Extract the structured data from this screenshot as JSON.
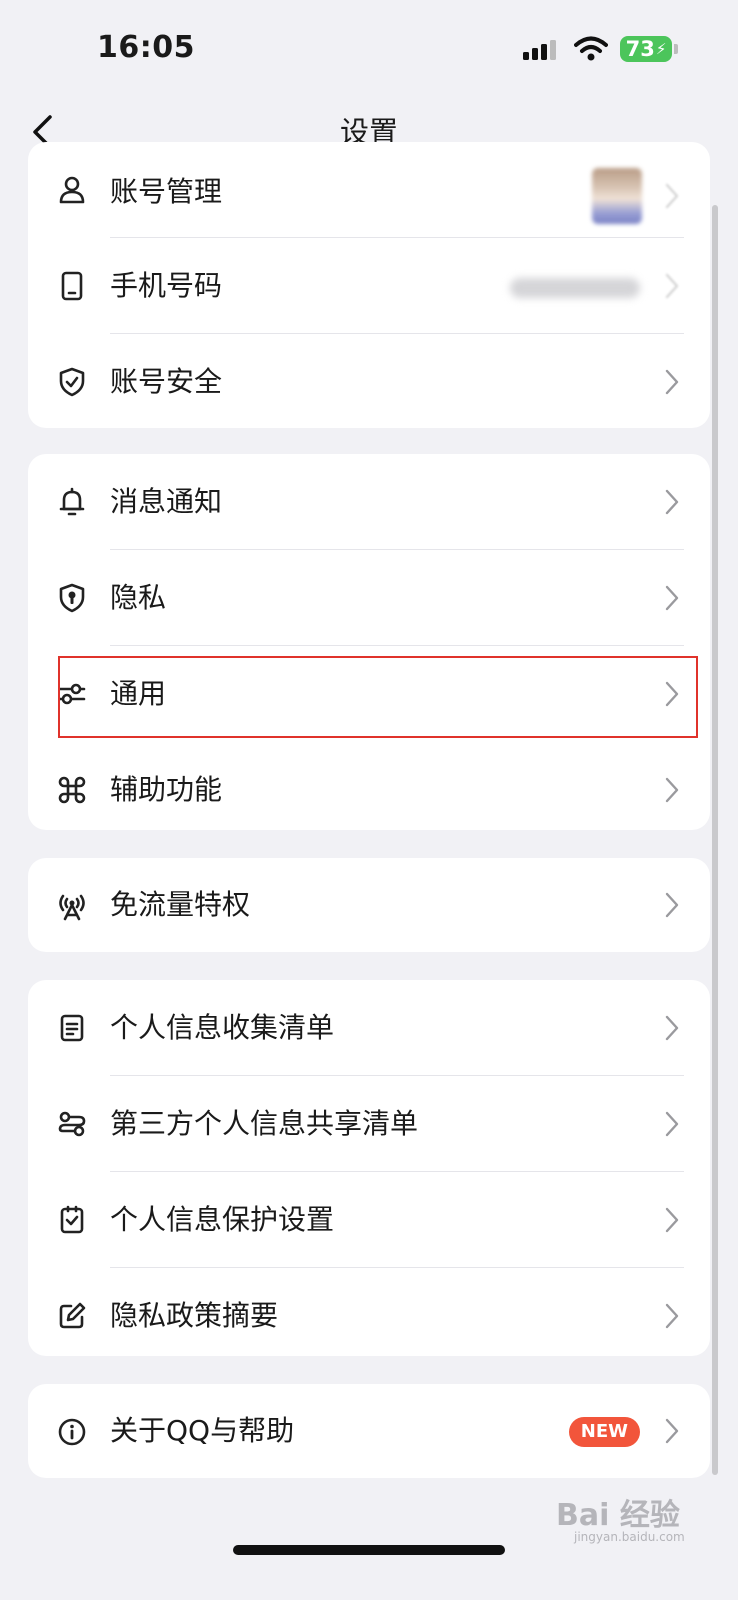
{
  "status_bar": {
    "time": "16:05",
    "battery": "73"
  },
  "nav": {
    "title": "设置"
  },
  "groups": [
    {
      "items": [
        {
          "icon": "person-icon",
          "label": "账号管理"
        },
        {
          "icon": "phone-icon",
          "label": "手机号码"
        },
        {
          "icon": "shield-check-icon",
          "label": "账号安全"
        }
      ]
    },
    {
      "items": [
        {
          "icon": "bell-icon",
          "label": "消息通知"
        },
        {
          "icon": "privacy-shield-icon",
          "label": "隐私"
        },
        {
          "icon": "sliders-icon",
          "label": "通用"
        },
        {
          "icon": "command-icon",
          "label": "辅助功能"
        }
      ]
    },
    {
      "items": [
        {
          "icon": "broadcast-icon",
          "label": "免流量特权"
        }
      ]
    },
    {
      "items": [
        {
          "icon": "document-icon",
          "label": "个人信息收集清单"
        },
        {
          "icon": "share-list-icon",
          "label": "第三方个人信息共享清单"
        },
        {
          "icon": "checklist-icon",
          "label": "个人信息保护设置"
        },
        {
          "icon": "edit-icon",
          "label": "隐私政策摘要"
        }
      ]
    },
    {
      "items": [
        {
          "icon": "info-icon",
          "label": "关于QQ与帮助",
          "badge": "NEW"
        }
      ]
    }
  ],
  "watermark": {
    "main": "Bai 经验",
    "sub": "jingyan.baidu.com"
  },
  "colors": {
    "background": "#f1f1f5",
    "card": "#ffffff",
    "highlight_border": "#e0322b",
    "badge": "#f2553b",
    "battery": "#4cc55b"
  }
}
